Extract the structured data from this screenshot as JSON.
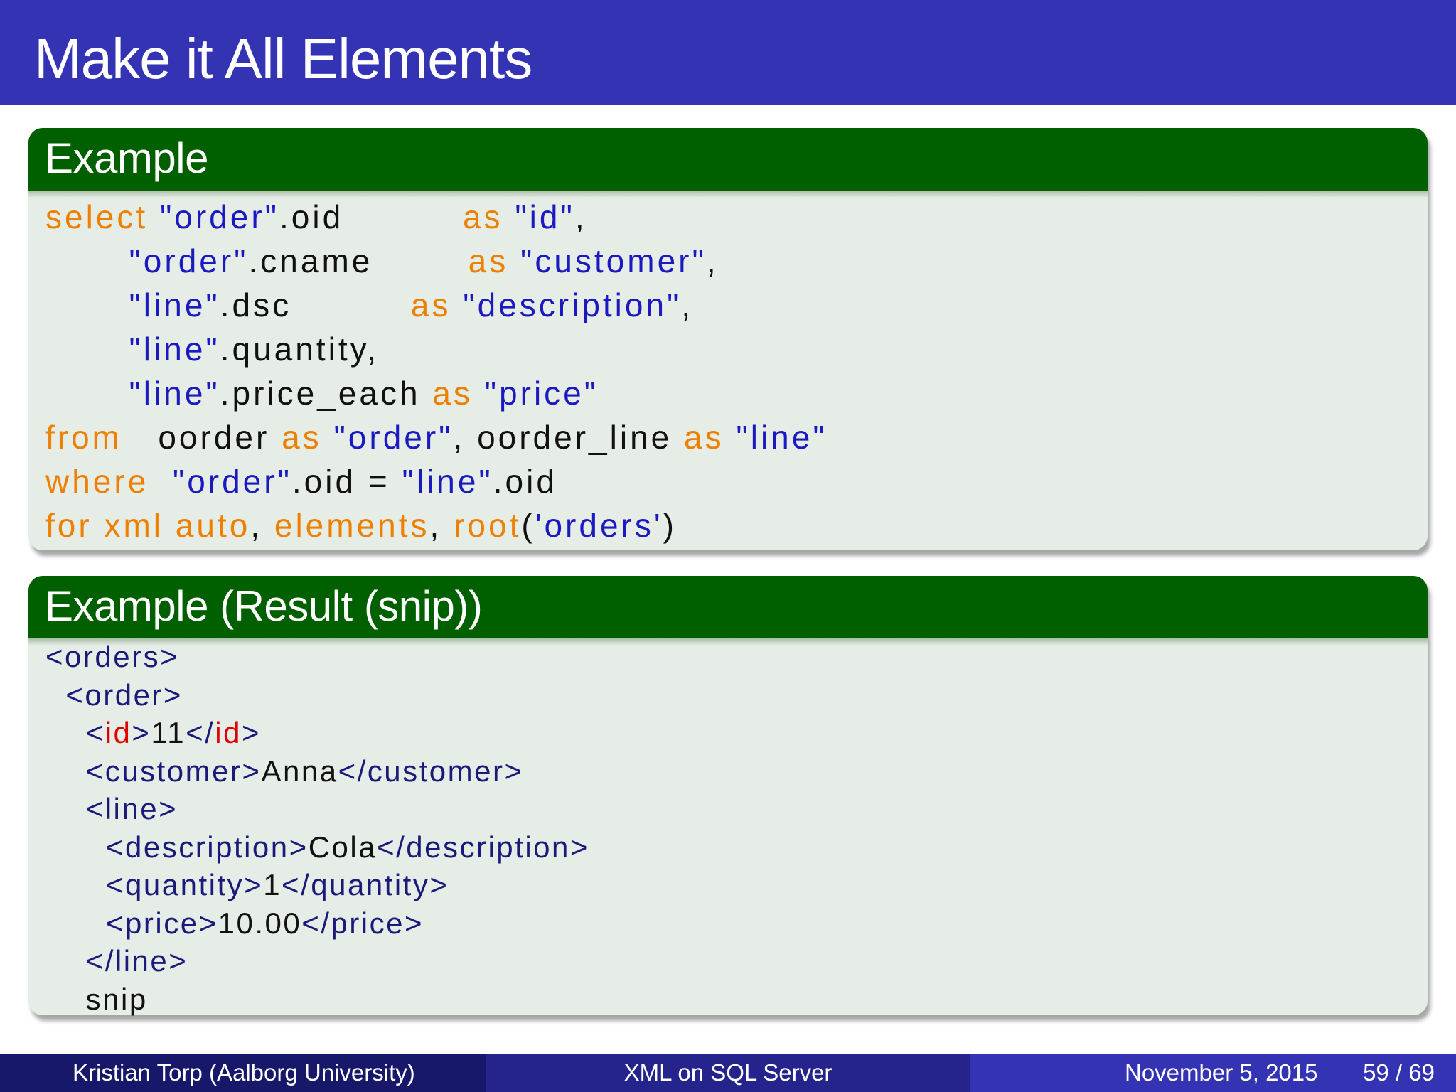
{
  "slide": {
    "title": "Make it All Elements"
  },
  "block1": {
    "title": "Example",
    "lines": [
      [
        [
          "kw",
          "select"
        ],
        [
          "n",
          " "
        ],
        [
          "str",
          "\"order\""
        ],
        [
          "n",
          ".oid          "
        ],
        [
          "kw",
          "as"
        ],
        [
          "n",
          " "
        ],
        [
          "str",
          "\"id\""
        ],
        [
          "n",
          ","
        ]
      ],
      [
        [
          "n",
          "       "
        ],
        [
          "str",
          "\"order\""
        ],
        [
          "n",
          ".cname        "
        ],
        [
          "kw",
          "as"
        ],
        [
          "n",
          " "
        ],
        [
          "str",
          "\"customer\""
        ],
        [
          "n",
          ","
        ]
      ],
      [
        [
          "n",
          "       "
        ],
        [
          "str",
          "\"line\""
        ],
        [
          "n",
          ".dsc          "
        ],
        [
          "kw",
          "as"
        ],
        [
          "n",
          " "
        ],
        [
          "str",
          "\"description\""
        ],
        [
          "n",
          ","
        ]
      ],
      [
        [
          "n",
          "       "
        ],
        [
          "str",
          "\"line\""
        ],
        [
          "n",
          ".quantity,"
        ]
      ],
      [
        [
          "n",
          "       "
        ],
        [
          "str",
          "\"line\""
        ],
        [
          "n",
          ".price_each "
        ],
        [
          "kw",
          "as"
        ],
        [
          "n",
          " "
        ],
        [
          "str",
          "\"price\""
        ]
      ],
      [
        [
          "kw",
          "from"
        ],
        [
          "n",
          "   oorder "
        ],
        [
          "kw",
          "as"
        ],
        [
          "n",
          " "
        ],
        [
          "str",
          "\"order\""
        ],
        [
          "n",
          ", oorder_line "
        ],
        [
          "kw",
          "as"
        ],
        [
          "n",
          " "
        ],
        [
          "str",
          "\"line\""
        ]
      ],
      [
        [
          "kw",
          "where"
        ],
        [
          "n",
          "  "
        ],
        [
          "str",
          "\"order\""
        ],
        [
          "n",
          ".oid = "
        ],
        [
          "str",
          "\"line\""
        ],
        [
          "n",
          ".oid"
        ]
      ],
      [
        [
          "kw",
          "for xml auto"
        ],
        [
          "n",
          ", "
        ],
        [
          "kw",
          "elements"
        ],
        [
          "n",
          ", "
        ],
        [
          "kw",
          "root"
        ],
        [
          "n",
          "("
        ],
        [
          "str",
          "'orders'"
        ],
        [
          "n",
          ")"
        ]
      ]
    ]
  },
  "block2": {
    "title": "Example (Result (snip))",
    "lines": [
      [
        [
          "n",
          ""
        ],
        [
          "tag",
          "<orders>"
        ]
      ],
      [
        [
          "n",
          "  "
        ],
        [
          "tag",
          "<order>"
        ]
      ],
      [
        [
          "n",
          "    "
        ],
        [
          "tag",
          "<"
        ],
        [
          "id",
          "id"
        ],
        [
          "tag",
          ">"
        ],
        [
          "n",
          "11"
        ],
        [
          "tag",
          "</"
        ],
        [
          "id",
          "id"
        ],
        [
          "tag",
          ">"
        ]
      ],
      [
        [
          "n",
          "    "
        ],
        [
          "tag",
          "<customer>"
        ],
        [
          "n",
          "Anna"
        ],
        [
          "tag",
          "</customer>"
        ]
      ],
      [
        [
          "n",
          "    "
        ],
        [
          "tag",
          "<line>"
        ]
      ],
      [
        [
          "n",
          "      "
        ],
        [
          "tag",
          "<description>"
        ],
        [
          "n",
          "Cola"
        ],
        [
          "tag",
          "</description>"
        ]
      ],
      [
        [
          "n",
          "      "
        ],
        [
          "tag",
          "<quantity>"
        ],
        [
          "n",
          "1"
        ],
        [
          "tag",
          "</quantity>"
        ]
      ],
      [
        [
          "n",
          "      "
        ],
        [
          "tag",
          "<price>"
        ],
        [
          "n",
          "10.00"
        ],
        [
          "tag",
          "</price>"
        ]
      ],
      [
        [
          "n",
          "    "
        ],
        [
          "tag",
          "</line>"
        ]
      ],
      [
        [
          "n",
          "    snip"
        ]
      ]
    ]
  },
  "footer": {
    "author": "Kristian Torp  (Aalborg University)",
    "talk_title": "XML on SQL Server",
    "date": "November 5, 2015",
    "page": "59 / 69"
  },
  "colors": {
    "title_bar": "#3333b3",
    "block_header": "#006000",
    "block_body": "#e6ece6",
    "keyword": "#ee8000",
    "string": "#1a1ac0",
    "xml_id_tag": "#dd0000"
  }
}
